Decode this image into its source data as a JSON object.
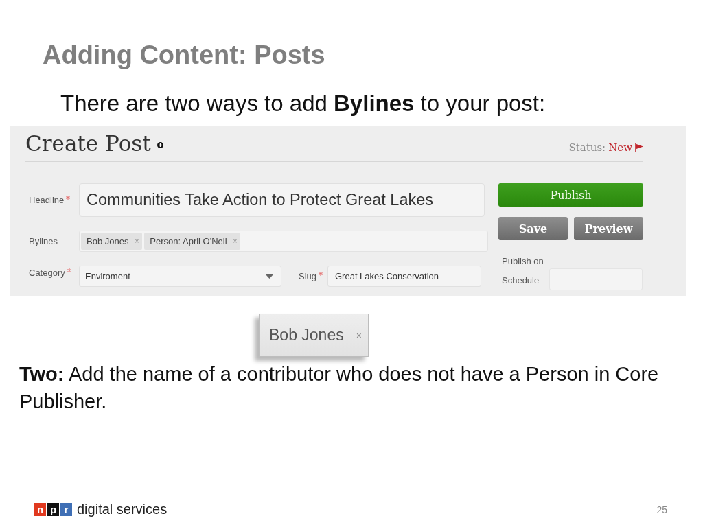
{
  "slide": {
    "title": "Adding Content: Posts",
    "intro": "There are two ways to add **Bylines** to your post:"
  },
  "form": {
    "title": "Create Post",
    "status_label": "Status:",
    "status_value": "New",
    "headline": {
      "label": "Headline",
      "required": true,
      "value": "Communities Take Action to Protect Great Lakes"
    },
    "bylines": {
      "label": "Bylines",
      "required": false,
      "tags": [
        {
          "label": "Bob Jones",
          "remove": "×"
        },
        {
          "label": "Person: April O'Neil",
          "remove": "×"
        }
      ]
    },
    "category": {
      "label": "Category",
      "required": true,
      "value": "Enviroment"
    },
    "slug": {
      "label": "Slug",
      "required": true,
      "value": "Great Lakes Conservation"
    },
    "buttons": [
      {
        "label": "Publish",
        "kind": "primary"
      },
      {
        "label": "Save",
        "kind": "secondary"
      },
      {
        "label": "Preview",
        "kind": "secondary"
      }
    ],
    "schedule": {
      "label": "Publish on Schedule"
    }
  },
  "closeup_tag": {
    "label": "Bob Jones",
    "remove": "×"
  },
  "body": "**Two:** Add the name of a contributor who does not have a Person in Core Publisher.",
  "footer": {
    "logo_letters": [
      {
        "letter": "n",
        "color": "#e0391f"
      },
      {
        "letter": "p",
        "color": "#111111"
      },
      {
        "letter": "r",
        "color": "#3f6fb5"
      }
    ],
    "logo_text": "digital services",
    "page_number": "25"
  }
}
